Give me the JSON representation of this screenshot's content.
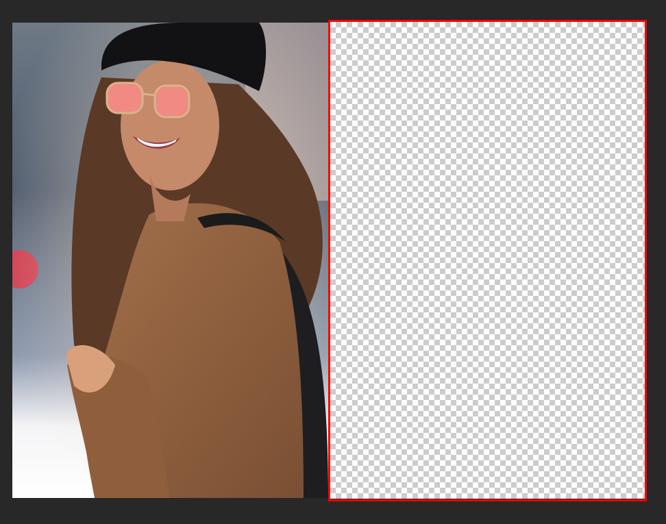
{
  "canvas": {
    "background_color": "#282828",
    "selection_color": "#ff0000",
    "layers": [
      {
        "name": "photo",
        "type": "image"
      },
      {
        "name": "transparent",
        "type": "empty"
      }
    ]
  }
}
